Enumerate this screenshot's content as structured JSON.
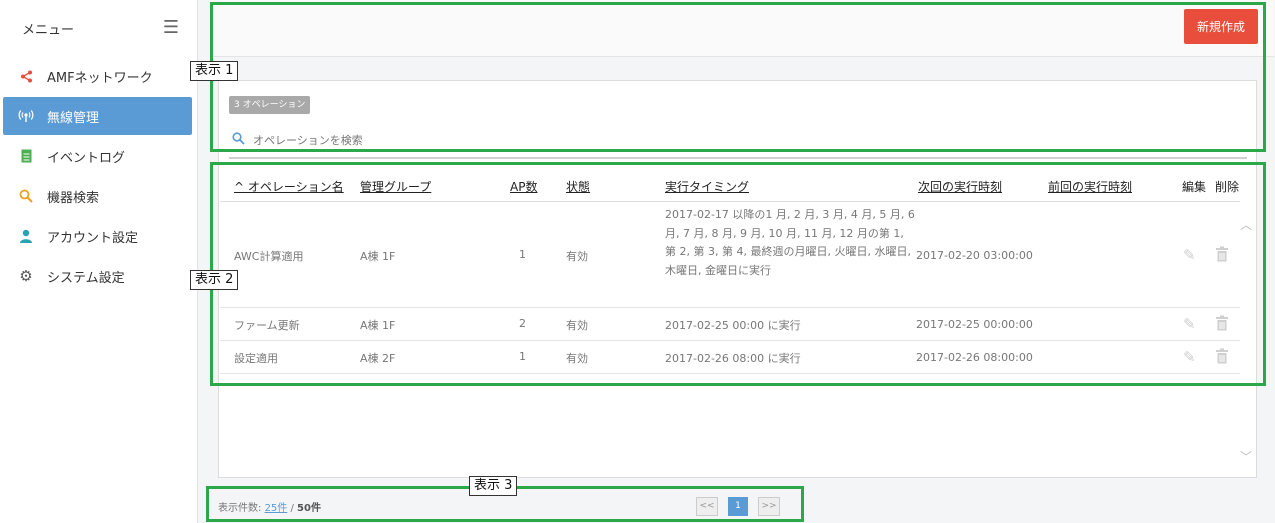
{
  "sidebar": {
    "title": "メニュー",
    "items": [
      {
        "label": "AMFネットワーク",
        "icon": "share-icon",
        "color": "#e94e3d"
      },
      {
        "label": "無線管理",
        "icon": "wireless-icon",
        "color": "#ffffff"
      },
      {
        "label": "イベントログ",
        "icon": "document-icon",
        "color": "#4caf50"
      },
      {
        "label": "機器検索",
        "icon": "search-icon",
        "color": "#f0a020"
      },
      {
        "label": "アカウント設定",
        "icon": "user-icon",
        "color": "#29a3b5"
      },
      {
        "label": "システム設定",
        "icon": "gear-icon",
        "color": "#555555"
      }
    ]
  },
  "toolbar": {
    "new_label": "新規作成"
  },
  "ops": {
    "badge": "3 オペレーション",
    "search_placeholder": "オペレーションを検索"
  },
  "table": {
    "headers": {
      "name": "^ オペレーション名",
      "group": "管理グループ",
      "ap": "AP数",
      "status": "状態",
      "timing": "実行タイミング",
      "next": "次回の実行時刻",
      "prev": "前回の実行時刻",
      "edit": "編集",
      "delete": "削除"
    },
    "rows": [
      {
        "name": "AWC計算適用",
        "group": "A棟 1F",
        "ap": "1",
        "status": "有効",
        "timing": "2017-02-17 以降の1 月, 2 月, 3 月, 4 月, 5 月, 6 月, 7 月, 8 月, 9 月, 10 月, 11 月, 12 月の第 1, 第 2, 第 3, 第 4, 最終週の月曜日, 火曜日, 水曜日, 木曜日, 金曜日に実行",
        "next": "2017-02-20 03:00:00",
        "prev": ""
      },
      {
        "name": "ファーム更新",
        "group": "A棟 1F",
        "ap": "2",
        "status": "有効",
        "timing": "2017-02-25 00:00 に実行",
        "next": "2017-02-25 00:00:00",
        "prev": ""
      },
      {
        "name": "設定適用",
        "group": "A棟 2F",
        "ap": "1",
        "status": "有効",
        "timing": "2017-02-26 08:00 に実行",
        "next": "2017-02-26 08:00:00",
        "prev": ""
      }
    ]
  },
  "footer": {
    "count_label": "表示件数:",
    "per_page": "25件",
    "separator": "/",
    "total": "50件",
    "prev": "<<",
    "page": "1",
    "next": ">>"
  },
  "annotations": {
    "label1": "表示 1",
    "label2": "表示 2",
    "label3": "表示 3",
    "frame_color": "#2aa84a"
  }
}
